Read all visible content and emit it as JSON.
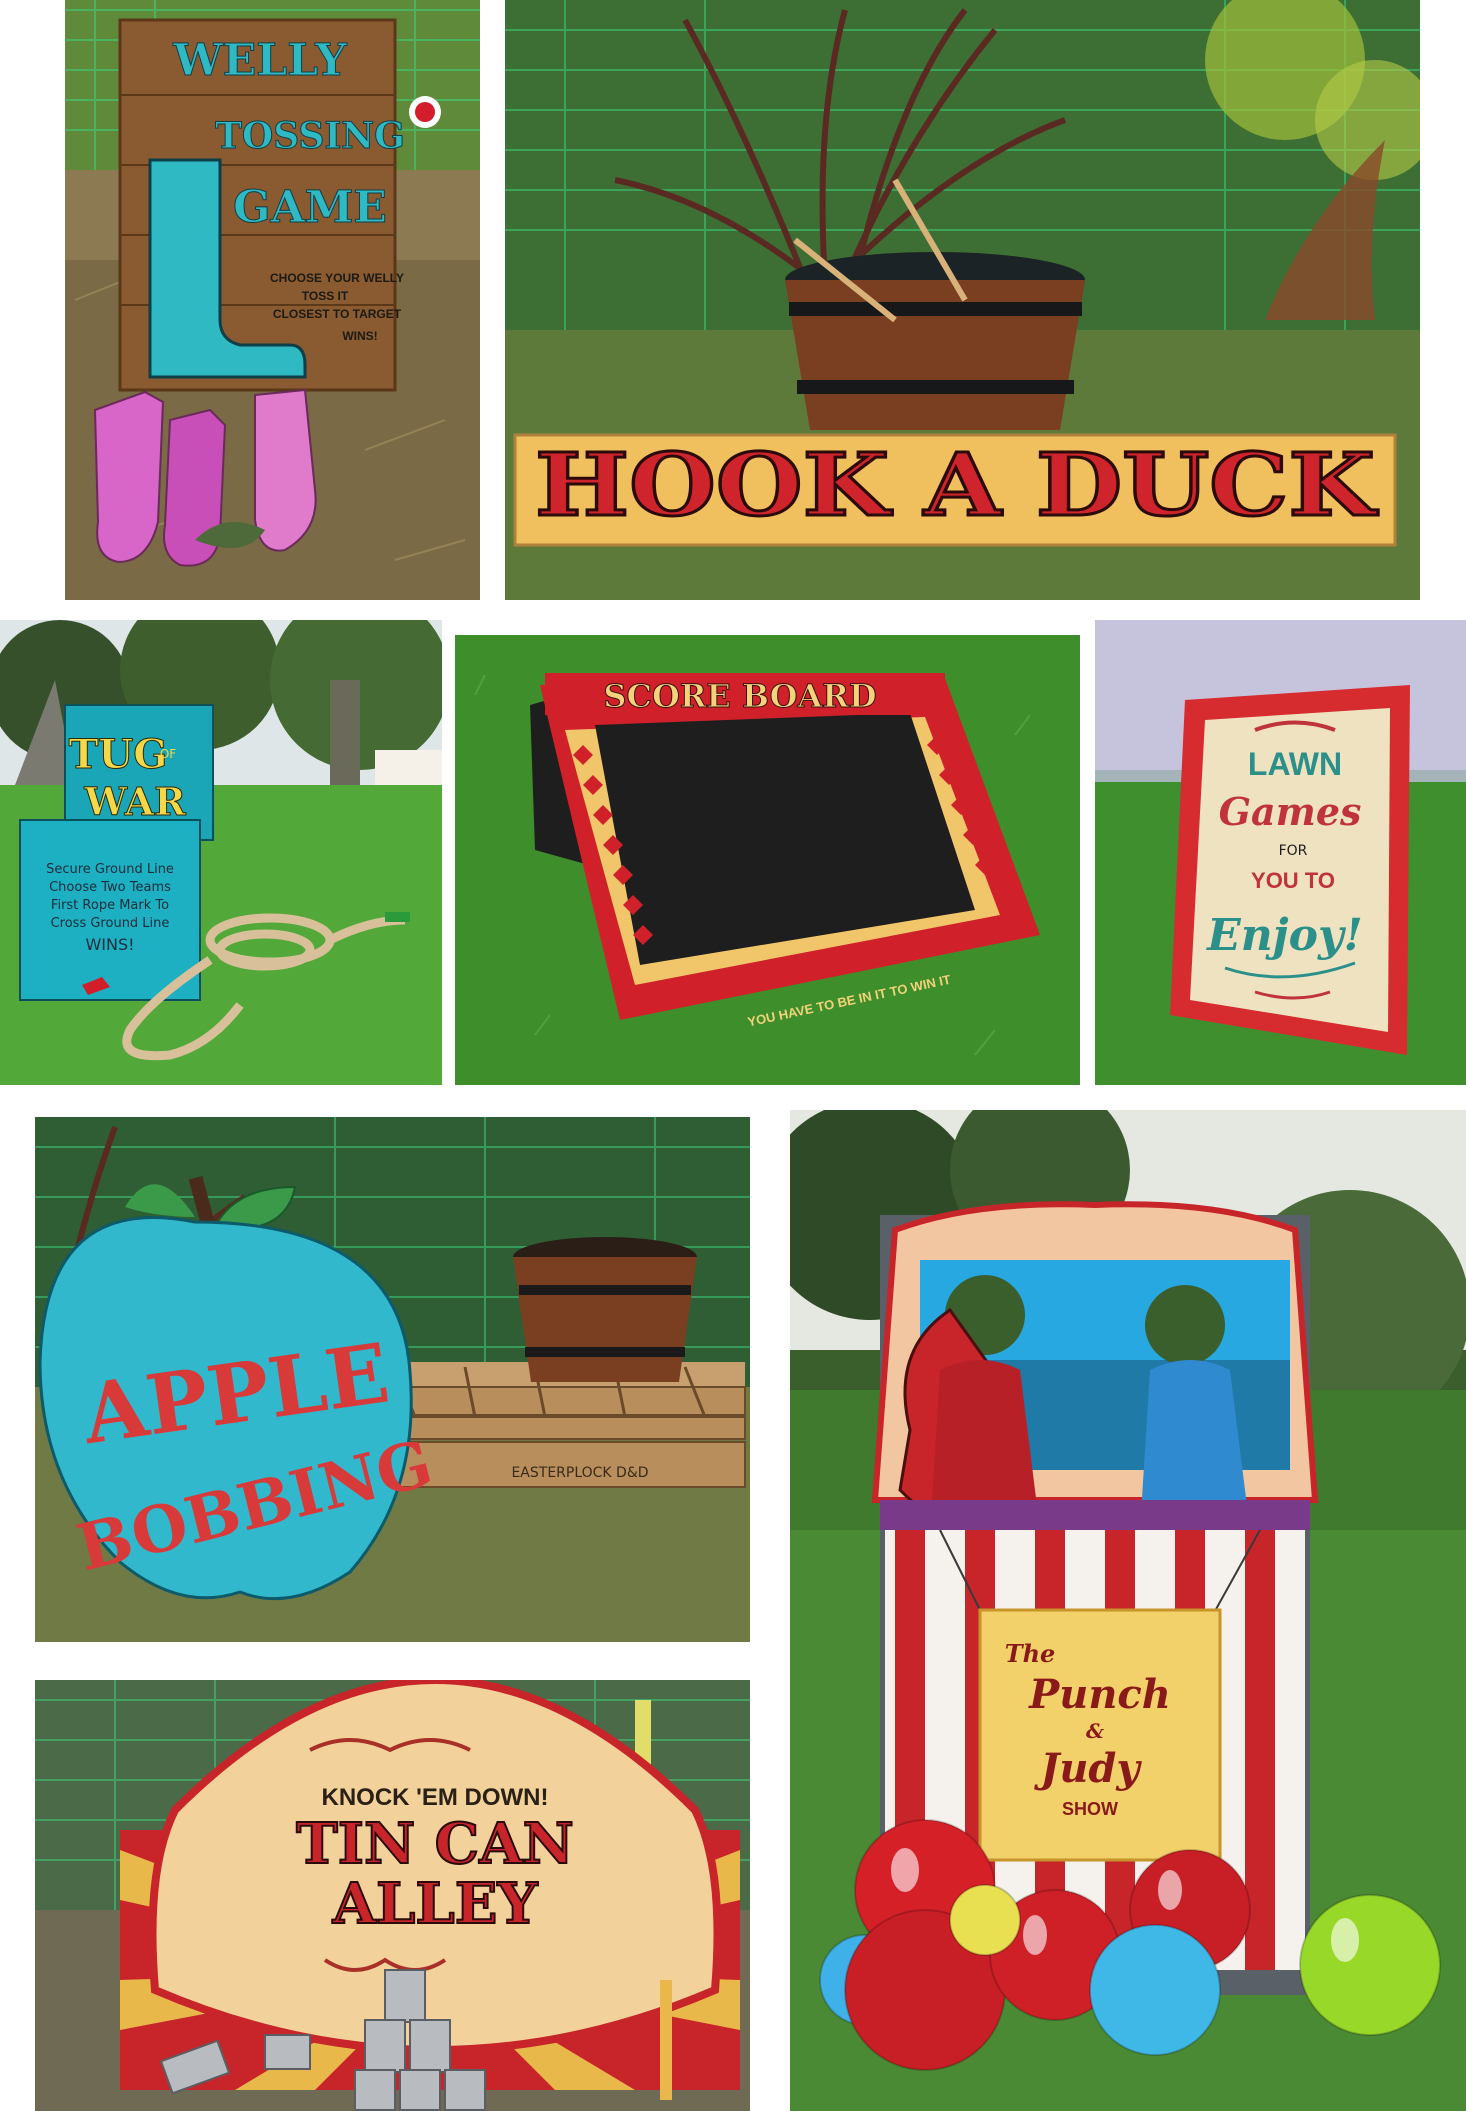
{
  "colors": {
    "grass": "#3f8a2a",
    "teal": "#2fb9c3",
    "red": "#cf2330",
    "cream": "#f2e6c4",
    "wood": "#8a5a30",
    "net": "#3ccf7a"
  },
  "photos": {
    "welly": {
      "title": [
        "WELLY",
        "TOSSING",
        "GAME"
      ],
      "rules": [
        "CHOOSE YOUR WELLY",
        "TOSS IT",
        "CLOSEST TO TARGET",
        "WINS!"
      ]
    },
    "duck": {
      "title": "HOOK A DUCK"
    },
    "tug": {
      "title_a": "TUG",
      "title_of": "OF",
      "title_b": "WAR",
      "rules": [
        "Secure Ground Line",
        "Choose Two Teams",
        "First Rope Mark To",
        "Cross Ground Line",
        "WINS!"
      ]
    },
    "score": {
      "title": "SCORE BOARD",
      "tagline": "YOU HAVE TO BE IN IT TO WIN IT"
    },
    "lawn": {
      "lines": [
        "LAWN",
        "Games",
        "FOR",
        "YOU TO",
        "Enjoy!"
      ]
    },
    "apple": {
      "lines": [
        "APPLE",
        "BOBBING"
      ],
      "pallet_stamp": "EASTERPLOCK D&D"
    },
    "tincan": {
      "lines": [
        "KNOCK 'EM DOWN!",
        "TIN CAN",
        "ALLEY"
      ]
    },
    "punch": {
      "lines": [
        "The",
        "Punch",
        "&",
        "Judy",
        "SHOW"
      ]
    }
  }
}
